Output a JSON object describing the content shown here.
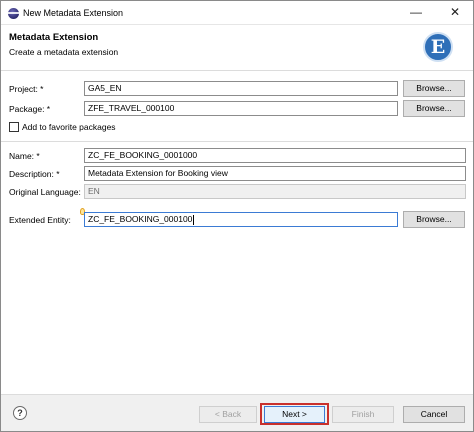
{
  "window": {
    "title": "New Metadata Extension",
    "minimize_glyph": "—",
    "close_glyph": "✕"
  },
  "header": {
    "title": "Metadata Extension",
    "subtitle": "Create a metadata extension",
    "icon_letter": "E"
  },
  "form": {
    "project": {
      "label": "Project: *",
      "value": "GA5_EN",
      "browse": "Browse..."
    },
    "package": {
      "label": "Package: *",
      "value": "ZFE_TRAVEL_000100",
      "browse": "Browse..."
    },
    "favorite": {
      "label": "Add to favorite packages",
      "checked": false
    },
    "name": {
      "label": "Name: *",
      "value": "ZC_FE_BOOKING_0001000"
    },
    "description": {
      "label": "Description: *",
      "value": "Metadata Extension for Booking view"
    },
    "original_language": {
      "label": "Original Language:",
      "value": "EN"
    },
    "extended_entity": {
      "label": "Extended Entity:",
      "value": "ZC_FE_BOOKING_000100",
      "browse": "Browse..."
    }
  },
  "footer": {
    "help_glyph": "?",
    "back": "< Back",
    "next": "Next >",
    "finish": "Finish",
    "cancel": "Cancel"
  },
  "colors": {
    "highlight": "#c9302c",
    "wizard_icon": "#2f6fb8"
  }
}
